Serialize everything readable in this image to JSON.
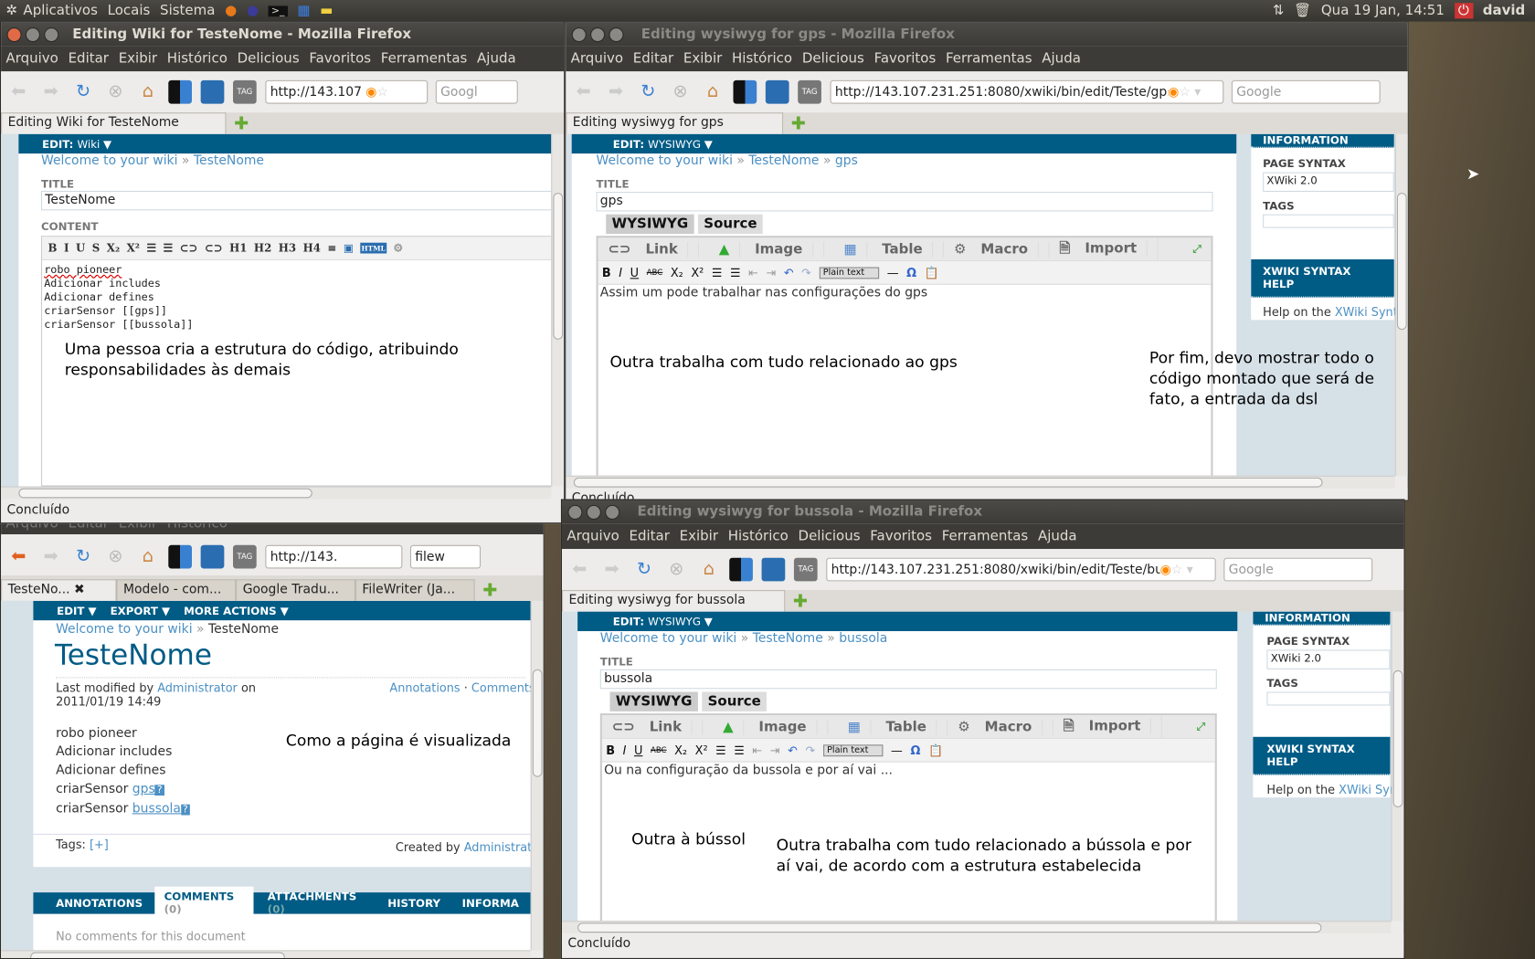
{
  "top_panel": {
    "menus": [
      "Aplicativos",
      "Locais",
      "Sistema"
    ],
    "clock": "Qua 19 Jan, 14:51",
    "user": "david"
  },
  "menu_items": [
    "Arquivo",
    "Editar",
    "Exibir",
    "Histórico",
    "Delicious",
    "Favoritos",
    "Ferramentas",
    "Ajuda"
  ],
  "status_done": "Concluído",
  "search_placeholder": "Google",
  "win_wiki": {
    "title": "Editing Wiki for TesteNome - Mozilla Firefox",
    "url": "http://143.107",
    "search": "Googl",
    "tab": "Editing Wiki for TesteNome",
    "edit_label": "EDIT:",
    "edit_mode": "Wiki ▼",
    "breadcrumb": [
      "Welcome to your wiki",
      "»",
      "TesteNome"
    ],
    "title_label": "TITLE",
    "title_value": "TesteNome",
    "content_label": "CONTENT",
    "toolbar": [
      "B",
      "I",
      "U",
      "S",
      "X₂",
      "X²",
      "☰",
      "☰",
      "⊂⊃",
      "⊂⊃",
      "H1",
      "H2",
      "H3",
      "H4",
      "≡",
      "▣",
      "HTML",
      "⚙"
    ],
    "code_lines": [
      "robo pioneer",
      "Adicionar includes",
      "Adicionar defines",
      "criarSensor [[gps]]",
      "criarSensor [[bussola]]"
    ],
    "note": "Uma pessoa cria a estrutura do código, atribuindo responsabilidades às demais"
  },
  "win_view": {
    "url": "http://143.",
    "search": "filew",
    "tabs": [
      "TesteNo...",
      "Modelo - com...",
      "Google Tradu...",
      "FileWriter (Ja..."
    ],
    "actions": [
      "EDIT ▼",
      "EXPORT ▼",
      "MORE ACTIONS ▼"
    ],
    "breadcrumb": [
      "Welcome to your wiki",
      "»",
      "TesteNome"
    ],
    "heading": "TesteNome",
    "modified_prefix": "Last modified by",
    "modified_by": "Administrator",
    "modified_on": "on 2011/01/19 14:49",
    "annotations_link": "Annotations",
    "comments_link": "Comments",
    "lines": [
      "robo pioneer",
      "Adicionar includes",
      "Adicionar defines"
    ],
    "sensor_prefix": "criarSensor",
    "sensor_links": [
      "gps",
      "bussola"
    ],
    "missing_mark": "?",
    "note": "Como a página é visualizada",
    "tags": "Tags:",
    "tags_add": "[+]",
    "created_prefix": "Created by",
    "created_by": "Administrat",
    "bottom_tabs": [
      "ANNOTATIONS",
      "COMMENTS",
      "(0)",
      "ATTACHMENTS",
      "(0)",
      "HISTORY",
      "INFORMA"
    ],
    "no_comments": "No comments for this document"
  },
  "win_gps": {
    "title": "Editing wysiwyg for gps - Mozilla Firefox",
    "url": "http://143.107.231.251:8080/xwiki/bin/edit/Teste/gps?",
    "tab": "Editing wysiwyg for gps",
    "edit_label": "EDIT:",
    "edit_mode": "WYSIWYG ▼",
    "breadcrumb": [
      "Welcome to your wiki",
      "»",
      "TesteNome",
      "»",
      "gps"
    ],
    "title_label": "TITLE",
    "title_value": "gps",
    "editor_tabs": [
      "WYSIWYG",
      "Source"
    ],
    "insert_bar": [
      "Link",
      "Image",
      "Table",
      "Macro",
      "Import"
    ],
    "format_bar": [
      "B",
      "I",
      "U",
      "ABC",
      "X₂",
      "X²",
      "☰",
      "☰",
      "⇤",
      "⇥",
      "↶",
      "↷"
    ],
    "style_select": "Plain text",
    "text": "Assim um pode trabalhar nas configurações do gps",
    "note1": "Outra trabalha com tudo relacionado ao gps",
    "note2": "Por fim, devo mostrar todo o código montado que será de fato, a entrada da dsl",
    "side": {
      "info": "INFORMATION",
      "syntax_label": "PAGE SYNTAX",
      "syntax": "XWiki 2.0",
      "tags_label": "TAGS",
      "help_title": "XWIKI SYNTAX HELP",
      "help_prefix": "Help on the",
      "help_link": "XWiki Synta"
    }
  },
  "win_bussola": {
    "title": "Editing wysiwyg for bussola - Mozilla Firefox",
    "url": "http://143.107.231.251:8080/xwiki/bin/edit/Teste/bussola",
    "tab": "Editing wysiwyg for bussola",
    "edit_label": "EDIT:",
    "edit_mode": "WYSIWYG ▼",
    "breadcrumb": [
      "Welcome to your wiki",
      "»",
      "TesteNome",
      "»",
      "bussola"
    ],
    "title_label": "TITLE",
    "title_value": "bussola",
    "text": "Ou na configuração da bussola e por aí vai ...",
    "note1": "Outra à bússol",
    "note2": "Outra trabalha com tudo relacionado a bússola e por aí vai, de acordo com a estrutura estabelecida",
    "side": {
      "info": "INFORMATION",
      "syntax_label": "PAGE SYNTAX",
      "syntax": "XWiki 2.0",
      "tags_label": "TAGS",
      "help_title": "XWIKI SYNTAX HELP",
      "help_prefix": "Help on the",
      "help_link": "XWiki Syn"
    }
  },
  "colors": {
    "xwiki_blue": "#005b85",
    "link": "#4c90c4",
    "panel": "#3c3b37"
  }
}
